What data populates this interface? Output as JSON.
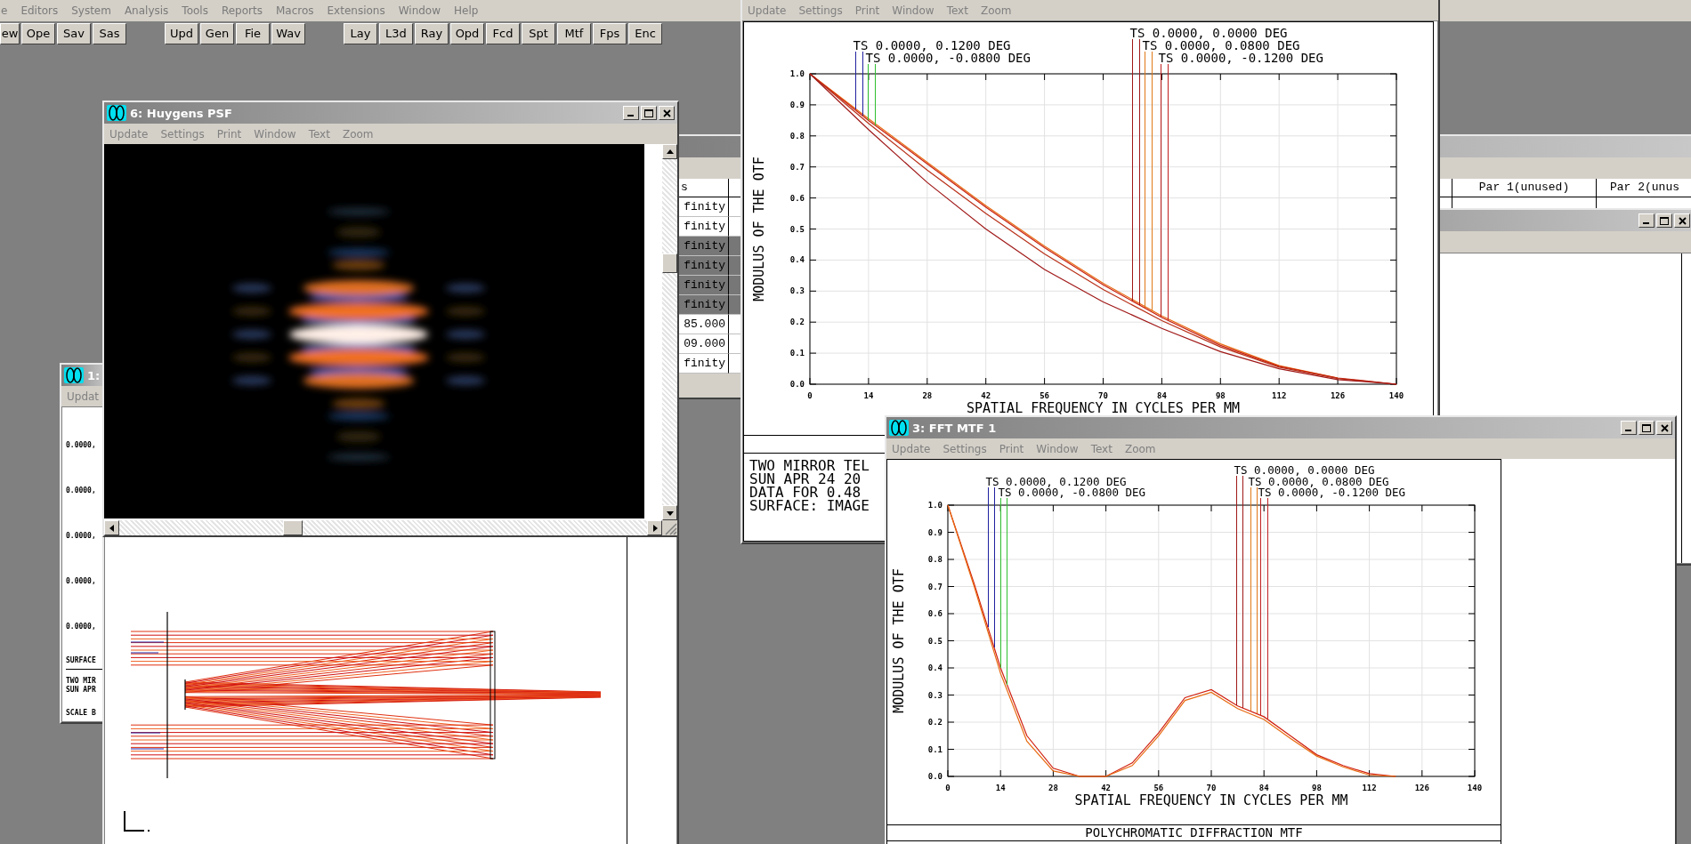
{
  "menu_bar": [
    "e",
    "Editors",
    "System",
    "Analysis",
    "Tools",
    "Reports",
    "Macros",
    "Extensions",
    "Window",
    "Help"
  ],
  "toolbar": [
    [
      "ew",
      "Ope",
      "Sav",
      "Sas"
    ],
    [
      "Upd",
      "Gen",
      "Fie",
      "Wav"
    ],
    [
      "Lay",
      "L3d",
      "Ray",
      "Opd",
      "Fcd",
      "Spt",
      "Mtf",
      "Fps",
      "Enc"
    ]
  ],
  "lens_editor": {
    "columns": [
      "s",
      "Par 1(unused)",
      "Par 2(unus"
    ],
    "rows": [
      {
        "value": "finity",
        "selected": false
      },
      {
        "value": "finity",
        "selected": false
      },
      {
        "value": "finity",
        "selected": true
      },
      {
        "value": "finity",
        "selected": true
      },
      {
        "value": "finity",
        "selected": true
      },
      {
        "value": "finity",
        "selected": true
      },
      {
        "value": "85.000",
        "selected": false
      },
      {
        "value": "09.000",
        "selected": false
      },
      {
        "value": "finity",
        "selected": false
      }
    ]
  },
  "mtf_window": {
    "menu": [
      "Update",
      "Settings",
      "Print",
      "Window",
      "Text",
      "Zoom"
    ],
    "chart_data": {
      "type": "line",
      "xlabel": "SPATIAL FREQUENCY IN CYCLES PER MM",
      "ylabel": "MODULUS OF THE OTF",
      "x": [
        0,
        14,
        28,
        42,
        56,
        70,
        84,
        98,
        112,
        126,
        140
      ],
      "series": [
        {
          "color": "#e86a10",
          "values": [
            1,
            0.855,
            0.715,
            0.575,
            0.445,
            0.325,
            0.22,
            0.13,
            0.06,
            0.02,
            null
          ]
        },
        {
          "color": "#c82010",
          "values": [
            1,
            0.85,
            0.71,
            0.57,
            0.44,
            0.32,
            0.215,
            0.125,
            0.058,
            0.02,
            0
          ]
        },
        {
          "color": "#b83018",
          "values": [
            1,
            0.84,
            0.69,
            0.55,
            0.42,
            0.305,
            0.205,
            0.12,
            0.055,
            0.018,
            0
          ]
        },
        {
          "color": "#a01818",
          "values": [
            1,
            0.82,
            0.65,
            0.5,
            0.37,
            0.265,
            0.18,
            0.105,
            0.05,
            0.015,
            0
          ]
        }
      ],
      "xlim": [
        0,
        140
      ],
      "ylim": [
        0,
        1
      ],
      "xticks": [
        0,
        14,
        28,
        42,
        56,
        70,
        84,
        98,
        112,
        126,
        140
      ],
      "grid": true,
      "yticks": [
        {
          "value": 0,
          "label": "0.0"
        },
        {
          "value": 0.1,
          "label": "0.1"
        },
        {
          "value": 0.2,
          "label": "0.2"
        },
        {
          "value": 0.3,
          "label": "0.3"
        },
        {
          "value": 0.4,
          "label": "0.4"
        },
        {
          "value": 0.5,
          "label": "0.5"
        },
        {
          "value": 0.6,
          "label": "0.6"
        },
        {
          "value": 0.7,
          "label": "0.7"
        },
        {
          "value": 0.8,
          "label": "0.8"
        },
        {
          "value": 0.9,
          "label": "0.9"
        },
        {
          "value": 1,
          "label": "1.0"
        }
      ]
    },
    "legend": [
      {
        "text": "TS 0.0000, 0.0000 DEG",
        "color": "#a01818"
      },
      {
        "text": "TS 0.0000, 0.1200 DEG",
        "color": "#2020a0"
      },
      {
        "text": "TS 0.0000, 0.0800 DEG",
        "color": "#e07818"
      },
      {
        "text": "TS 0.0000, -0.0800 DEG",
        "color": "#30c030"
      },
      {
        "text": "TS 0.0000, -0.1200 DEG",
        "color": "#c02020"
      }
    ],
    "text_block": [
      "TWO MIRROR TEL",
      "SUN APR 24 20",
      "DATA FOR 0.48",
      "SURFACE: IMAGE"
    ]
  },
  "huygens_window": {
    "title": "6: Huygens PSF",
    "menu": [
      "Update",
      "Settings",
      "Print",
      "Window",
      "Text",
      "Zoom"
    ]
  },
  "window_1": {
    "title": "1:",
    "menu": [
      "Updat"
    ],
    "field_labels": [
      "0.0000,",
      "0.0000,",
      "0.0000,",
      "0.0000,",
      "0.0000,"
    ],
    "surface_label": "SURFACE",
    "notes": [
      "TWO MIR",
      "SUN APR"
    ],
    "scale_label": "SCALE B"
  },
  "fft_window": {
    "title": "3: FFT MTF 1",
    "menu": [
      "Update",
      "Settings",
      "Print",
      "Window",
      "Text",
      "Zoom"
    ],
    "chart_data": {
      "type": "line",
      "xlabel": "SPATIAL FREQUENCY IN CYCLES PER MM",
      "ylabel": "MODULUS OF THE OTF",
      "x": [
        0,
        7,
        14,
        21,
        28,
        35,
        42,
        49,
        56,
        63,
        70,
        77,
        84,
        91,
        98,
        105,
        112,
        119
      ],
      "series": [
        {
          "color": "#d02010",
          "values": [
            1,
            0.71,
            0.4,
            0.15,
            0.03,
            0,
            0,
            0.05,
            0.16,
            0.29,
            0.32,
            0.26,
            0.22,
            0.15,
            0.08,
            0.04,
            0.01,
            0
          ]
        },
        {
          "color": "#e86a10",
          "values": [
            1,
            0.7,
            0.38,
            0.13,
            0.02,
            0,
            0,
            0.04,
            0.15,
            0.28,
            0.31,
            0.25,
            0.21,
            0.14,
            0.075,
            0.035,
            0.005,
            0
          ]
        }
      ],
      "xlim": [
        0,
        140
      ],
      "ylim": [
        0,
        1
      ],
      "xticks": [
        0,
        14,
        28,
        42,
        56,
        70,
        84,
        98,
        112,
        126,
        140
      ],
      "grid": true,
      "yticks": [
        {
          "value": 0,
          "label": "0.0"
        },
        {
          "value": 0.1,
          "label": "0.1"
        },
        {
          "value": 0.2,
          "label": "0.2"
        },
        {
          "value": 0.3,
          "label": "0.3"
        },
        {
          "value": 0.4,
          "label": "0.4"
        },
        {
          "value": 0.5,
          "label": "0.5"
        },
        {
          "value": 0.6,
          "label": "0.6"
        },
        {
          "value": 0.7,
          "label": "0.7"
        },
        {
          "value": 0.8,
          "label": "0.8"
        },
        {
          "value": 0.9,
          "label": "0.9"
        },
        {
          "value": 1,
          "label": "1.0"
        }
      ]
    },
    "legend": [
      {
        "text": "TS 0.0000, 0.0000 DEG",
        "color": "#a01818"
      },
      {
        "text": "TS 0.0000, 0.1200 DEG",
        "color": "#2020a0"
      },
      {
        "text": "TS 0.0000, 0.0800 DEG",
        "color": "#e07818"
      },
      {
        "text": "TS 0.0000, -0.0800 DEG",
        "color": "#30c030"
      },
      {
        "text": "TS 0.0000, -0.1200 DEG",
        "color": "#c02020"
      }
    ],
    "caption": "POLYCHROMATIC DIFFRACTION MTF"
  }
}
